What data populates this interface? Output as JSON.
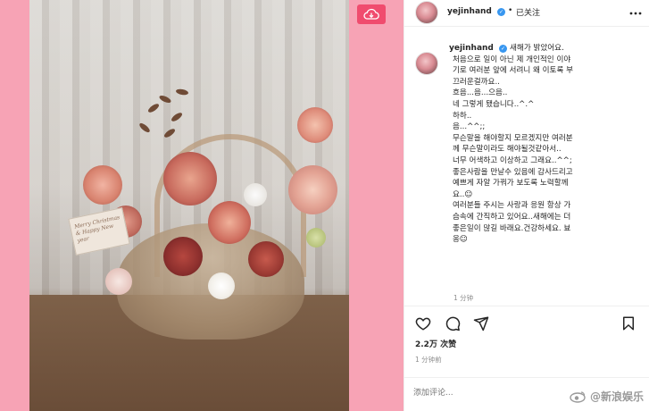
{
  "header": {
    "username": "yejinhand",
    "verified_mark": "✓",
    "dot": "•",
    "follow_label": "已关注",
    "more_label": "···"
  },
  "post": {
    "username": "yejinhand",
    "caption": "새해가 밝았어요.\n처음으로 일이 아닌 제 개인적인 이야\n기로 여러분 앞에 서려니 왜 이토록 부\n끄러운걸까요..\n흐음...음...으음..\n네 그렇게 됐습니다..^.^\n하하..\n음...^^;;\n무슨말을 해야할지 모르겠지만 여러분\n께 무슨말이라도 해야될것같아서..\n너무 어색하고 이상하고 그래요..^^;\n좋은사람을 만날수 있음에 감사드리고\n예쁘게 자알 가꿔가 보도록 노력할께\n요..☺\n여러분들 주시는 사랑과 응원 항상 가\n슴속에 간직하고 있어요..새해에는 더\n좋은일이 많길 바래요.건강하세요. 뵤\n옹☺",
    "caption_time": "1 分钟",
    "likes": "2.2万 次赞",
    "post_time": "1 分钟前"
  },
  "card_text": "Merry Christmas & Happy New year",
  "comment": {
    "placeholder": "添加评论..."
  },
  "watermark": {
    "text": "@新浪娱乐"
  },
  "colors": {
    "background_pink": "#f7a3b5",
    "verified_blue": "#3897f0",
    "cloud_button": "#f04c6e"
  },
  "icons": [
    "cloud-download-icon",
    "heart-icon",
    "comment-icon",
    "send-icon",
    "bookmark-icon",
    "more-icon",
    "weibo-eye-icon"
  ]
}
